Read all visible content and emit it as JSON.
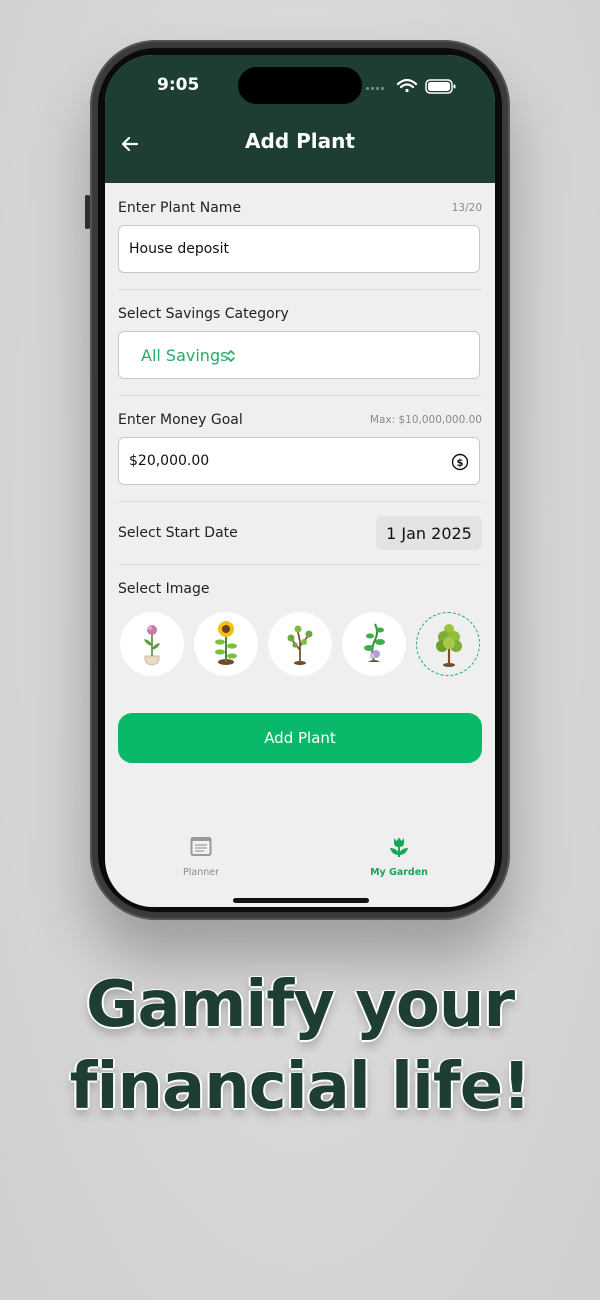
{
  "status_bar": {
    "time": "9:05"
  },
  "header": {
    "title": "Add Plant"
  },
  "form": {
    "plant_name": {
      "label": "Enter Plant Name",
      "counter": "13/20",
      "value": "House deposit"
    },
    "category": {
      "label": "Select Savings Category",
      "value": "All Savings"
    },
    "money_goal": {
      "label": "Enter Money Goal",
      "max_hint": "Max: $10,000,000.00",
      "value": "$20,000.00"
    },
    "start_date": {
      "label": "Select Start Date",
      "value": "1 Jan 2025"
    },
    "image": {
      "label": "Select Image",
      "options": [
        "potted-flower",
        "sunflower",
        "young-tree",
        "flowering-vine",
        "pine-tree"
      ],
      "selected_index": 4
    },
    "submit_label": "Add Plant"
  },
  "tab_bar": {
    "tabs": [
      {
        "label": "Planner",
        "icon": "planner-icon",
        "active": false
      },
      {
        "label": "My Garden",
        "icon": "tulip-icon",
        "active": true
      }
    ]
  },
  "tagline": {
    "line1": "Gamify your",
    "line2": "financial life!"
  },
  "colors": {
    "header": "#1e3d33",
    "accent": "#0ab86a",
    "accent_text": "#22ad6a",
    "tagline": "#1e3d33"
  }
}
